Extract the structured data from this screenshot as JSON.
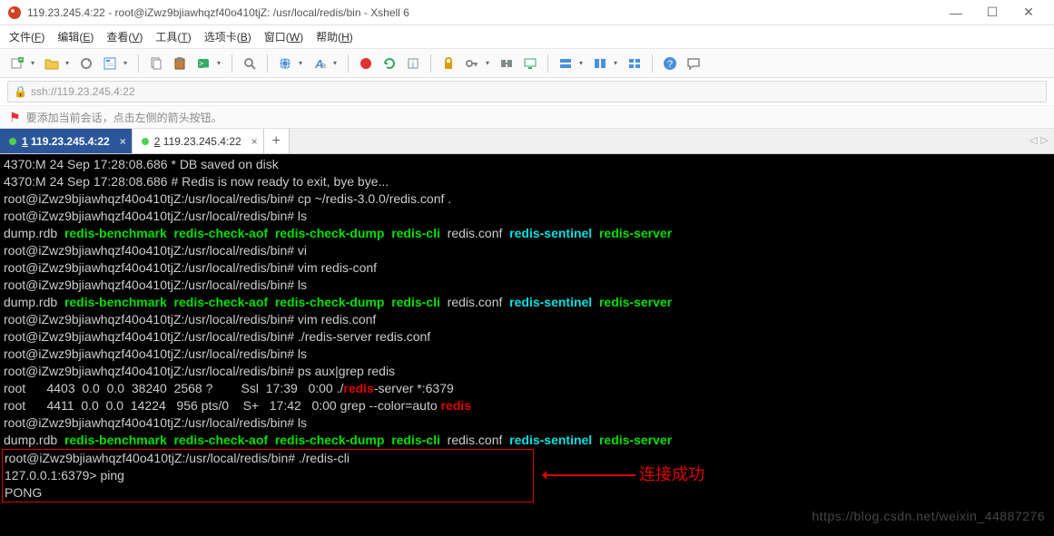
{
  "titlebar": {
    "title": "119.23.245.4:22 - root@iZwz9bjiawhqzf40o410tjZ: /usr/local/redis/bin - Xshell 6"
  },
  "menubar": [
    {
      "label": "文件",
      "key": "F"
    },
    {
      "label": "编辑",
      "key": "E"
    },
    {
      "label": "查看",
      "key": "V"
    },
    {
      "label": "工具",
      "key": "T"
    },
    {
      "label": "选项卡",
      "key": "B"
    },
    {
      "label": "窗口",
      "key": "W"
    },
    {
      "label": "帮助",
      "key": "H"
    }
  ],
  "addrbar": {
    "url": "ssh://119.23.245.4:22"
  },
  "infobar": {
    "text": "要添加当前会话，点击左侧的箭头按钮。"
  },
  "tabs": [
    {
      "label": "1 119.23.245.4:22",
      "active": true
    },
    {
      "label": "2 119.23.245.4:22",
      "active": false
    }
  ],
  "terminal": {
    "lines": [
      [
        {
          "t": "4370:M 24 Sep 17:28:08.686 * DB saved on disk"
        }
      ],
      [
        {
          "t": "4370:M 24 Sep 17:28:08.686 # Redis is now ready to exit, bye bye..."
        }
      ],
      [
        {
          "t": "root@iZwz9bjiawhqzf40o410tjZ:/usr/local/redis/bin# cp ~/redis-3.0.0/redis.conf ."
        }
      ],
      [
        {
          "t": "root@iZwz9bjiawhqzf40o410tjZ:/usr/local/redis/bin# ls"
        }
      ],
      [
        {
          "t": "dump.rdb  "
        },
        {
          "t": "redis-benchmark",
          "c": "green"
        },
        {
          "t": "  "
        },
        {
          "t": "redis-check-aof",
          "c": "green"
        },
        {
          "t": "  "
        },
        {
          "t": "redis-check-dump",
          "c": "green"
        },
        {
          "t": "  "
        },
        {
          "t": "redis-cli",
          "c": "green"
        },
        {
          "t": "  redis.conf  "
        },
        {
          "t": "redis-sentinel",
          "c": "cyan"
        },
        {
          "t": "  "
        },
        {
          "t": "redis-server",
          "c": "green"
        }
      ],
      [
        {
          "t": "root@iZwz9bjiawhqzf40o410tjZ:/usr/local/redis/bin# vi"
        }
      ],
      [
        {
          "t": "root@iZwz9bjiawhqzf40o410tjZ:/usr/local/redis/bin# vim redis-conf"
        }
      ],
      [
        {
          "t": "root@iZwz9bjiawhqzf40o410tjZ:/usr/local/redis/bin# ls"
        }
      ],
      [
        {
          "t": "dump.rdb  "
        },
        {
          "t": "redis-benchmark",
          "c": "green"
        },
        {
          "t": "  "
        },
        {
          "t": "redis-check-aof",
          "c": "green"
        },
        {
          "t": "  "
        },
        {
          "t": "redis-check-dump",
          "c": "green"
        },
        {
          "t": "  "
        },
        {
          "t": "redis-cli",
          "c": "green"
        },
        {
          "t": "  redis.conf  "
        },
        {
          "t": "redis-sentinel",
          "c": "cyan"
        },
        {
          "t": "  "
        },
        {
          "t": "redis-server",
          "c": "green"
        }
      ],
      [
        {
          "t": "root@iZwz9bjiawhqzf40o410tjZ:/usr/local/redis/bin# vim redis.conf"
        }
      ],
      [
        {
          "t": "root@iZwz9bjiawhqzf40o410tjZ:/usr/local/redis/bin# ./redis-server redis.conf"
        }
      ],
      [
        {
          "t": "root@iZwz9bjiawhqzf40o410tjZ:/usr/local/redis/bin# ls"
        }
      ],
      [
        {
          "t": "root@iZwz9bjiawhqzf40o410tjZ:/usr/local/redis/bin# ps aux|grep redis"
        }
      ],
      [
        {
          "t": "root      4403  0.0  0.0  38240  2568 ?        Ssl  17:39   0:00 ./"
        },
        {
          "t": "redis",
          "c": "red"
        },
        {
          "t": "-server *:6379"
        }
      ],
      [
        {
          "t": "root      4411  0.0  0.0  14224   956 pts/0    S+   17:42   0:00 grep --color=auto "
        },
        {
          "t": "redis",
          "c": "red"
        }
      ],
      [
        {
          "t": "root@iZwz9bjiawhqzf40o410tjZ:/usr/local/redis/bin# ls"
        }
      ],
      [
        {
          "t": "dump.rdb  "
        },
        {
          "t": "redis-benchmark",
          "c": "green"
        },
        {
          "t": "  "
        },
        {
          "t": "redis-check-aof",
          "c": "green"
        },
        {
          "t": "  "
        },
        {
          "t": "redis-check-dump",
          "c": "green"
        },
        {
          "t": "  "
        },
        {
          "t": "redis-cli",
          "c": "green"
        },
        {
          "t": "  redis.conf  "
        },
        {
          "t": "redis-sentinel",
          "c": "cyan"
        },
        {
          "t": "  "
        },
        {
          "t": "redis-server",
          "c": "green"
        }
      ]
    ],
    "box_lines": [
      [
        {
          "t": "root@iZwz9bjiawhqzf40o410tjZ:/usr/local/redis/bin# ./redis-cli"
        }
      ],
      [
        {
          "t": "127.0.0.1:6379> ping"
        }
      ],
      [
        {
          "t": "PONG"
        }
      ]
    ]
  },
  "annot": {
    "label": "连接成功"
  },
  "watermark": "https://blog.csdn.net/weixin_44887276"
}
